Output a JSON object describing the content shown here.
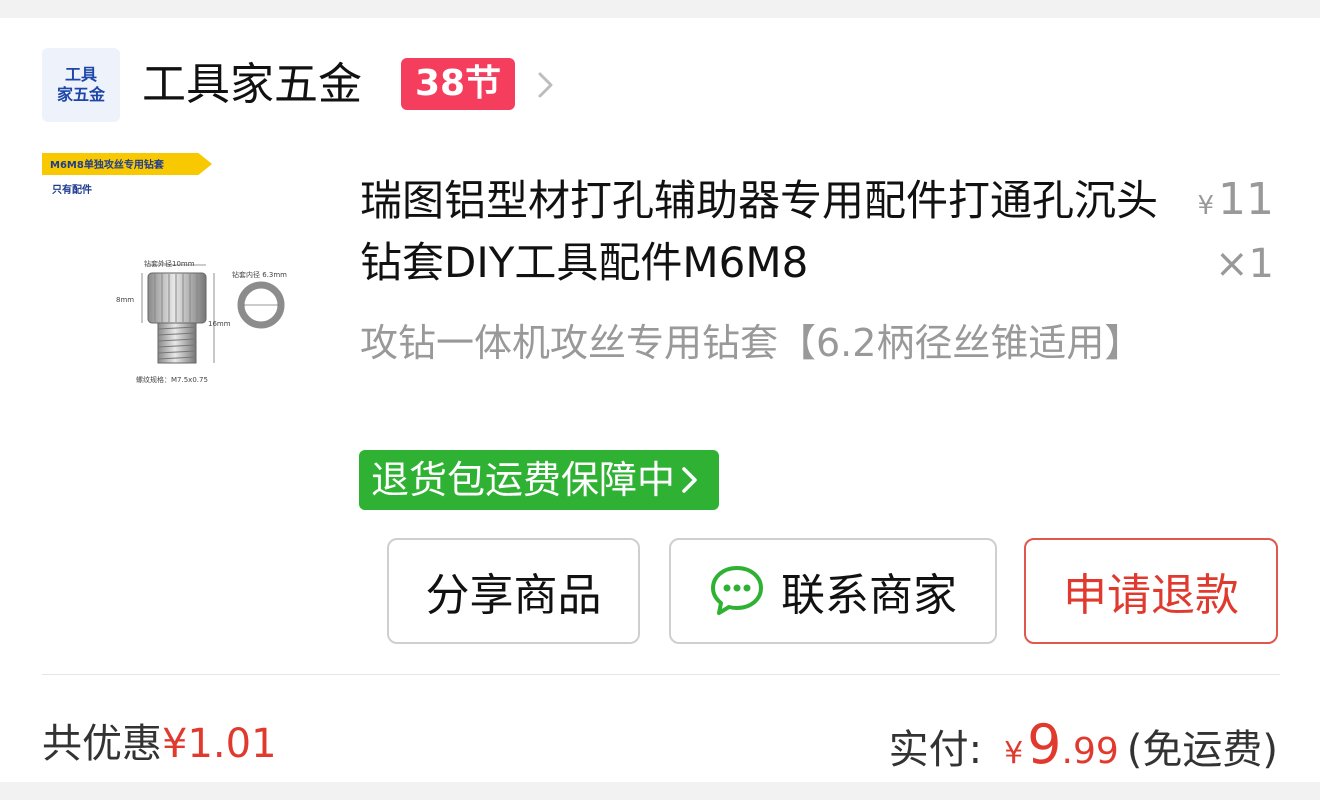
{
  "shop": {
    "logo_line1": "工具",
    "logo_line2": "家五金",
    "name": "工具家五金",
    "promo_badge": "38节",
    "chevron_icon": "chevron-right-icon"
  },
  "product": {
    "image": {
      "banner": "M6M8单独攻丝专用钻套",
      "subtitle": "只有配件",
      "label_outer": "钻套外径10mm",
      "label_inner": "钻套内径 6.3mm",
      "label_height": "8mm",
      "label_length": "16mm",
      "label_thread": "螺纹规格：M7.5x0.75"
    },
    "title": "瑞图铝型材打孔辅助器专用配件打通孔沉头钻套DIY工具配件M6M8",
    "spec": "攻钻一体机攻丝专用钻套【6.2柄径丝锥适用】",
    "currency": "¥",
    "unit_price": "11",
    "quantity": "×1",
    "return_badge": "退货包运费保障中",
    "return_badge_icon": "chevron-right-icon"
  },
  "actions": {
    "share": "分享商品",
    "contact": "联系商家",
    "contact_icon": "chat-bubble-icon",
    "refund": "申请退款"
  },
  "summary": {
    "discount_label": "共优惠",
    "discount_amount": "¥1.01",
    "paid_label": "实付:",
    "paid_currency": "¥",
    "paid_int": "9",
    "paid_dec": ".99",
    "shipping": "(免运费)"
  },
  "colors": {
    "promo_badge": "#f53d5d",
    "return_badge": "#2fb233",
    "price_red": "#e03a2f",
    "wechat_green": "#2fb233"
  }
}
